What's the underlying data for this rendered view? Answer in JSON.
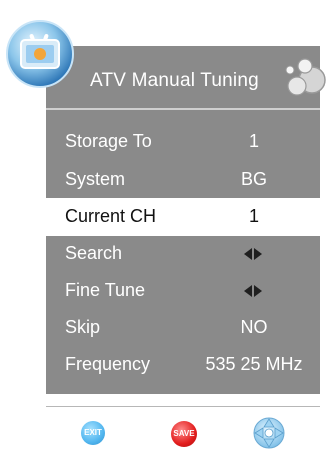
{
  "header": {
    "title": "ATV Manual Tuning"
  },
  "menu": {
    "items": [
      {
        "label": "Storage To",
        "value": "1"
      },
      {
        "label": "System",
        "value": "BG"
      },
      {
        "label": "Current CH",
        "value": "1"
      },
      {
        "label": "Search",
        "icon": "left-right-arrows-icon"
      },
      {
        "label": "Fine Tune",
        "icon": "left-right-arrows-icon"
      },
      {
        "label": "Skip",
        "value": "NO"
      },
      {
        "label": "Frequency",
        "value": "535 25 MHz"
      }
    ],
    "selected_index": 2
  },
  "footer": {
    "exit_label": "EXIT",
    "save_label": "SAVE",
    "nav_icon": "navigation-pad-icon"
  },
  "colors": {
    "panel": "#8a8a8a",
    "selected_row": "#ffffff",
    "exit": "#52b6ef",
    "save": "#e21d1d"
  }
}
